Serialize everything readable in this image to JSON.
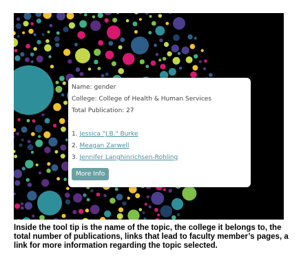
{
  "tooltip": {
    "name_line": "Name: gender",
    "college_line": "College: College of Health & Human Services",
    "total_line": "Total Publication: 27",
    "faculty": [
      {
        "num": "1.",
        "name": "Jessica \"J.B.\" Burke"
      },
      {
        "num": "2.",
        "name": "Meagan Zarwell"
      },
      {
        "num": "3.",
        "name": "Jennifer Langhinrichsen-Rohling"
      }
    ],
    "more_info_label": "More Info"
  },
  "caption": "Inside the tool tip is the name of the topic, the college it belongs to, the total number of publications, links that lead to faculty member’s pages, a link for more information regarding the topic selected.",
  "colors": {
    "background": "#000000",
    "bubble_palette": [
      "#2e8f9a",
      "#c4d64a",
      "#2f5d8a",
      "#d6186f",
      "#4b3e8c",
      "#3fae8a",
      "#f2c12e",
      "#7fbf4a",
      "#1e3f66",
      "#5a2d82"
    ],
    "link": "#4c8fa0",
    "button": "#6aa2a4"
  }
}
